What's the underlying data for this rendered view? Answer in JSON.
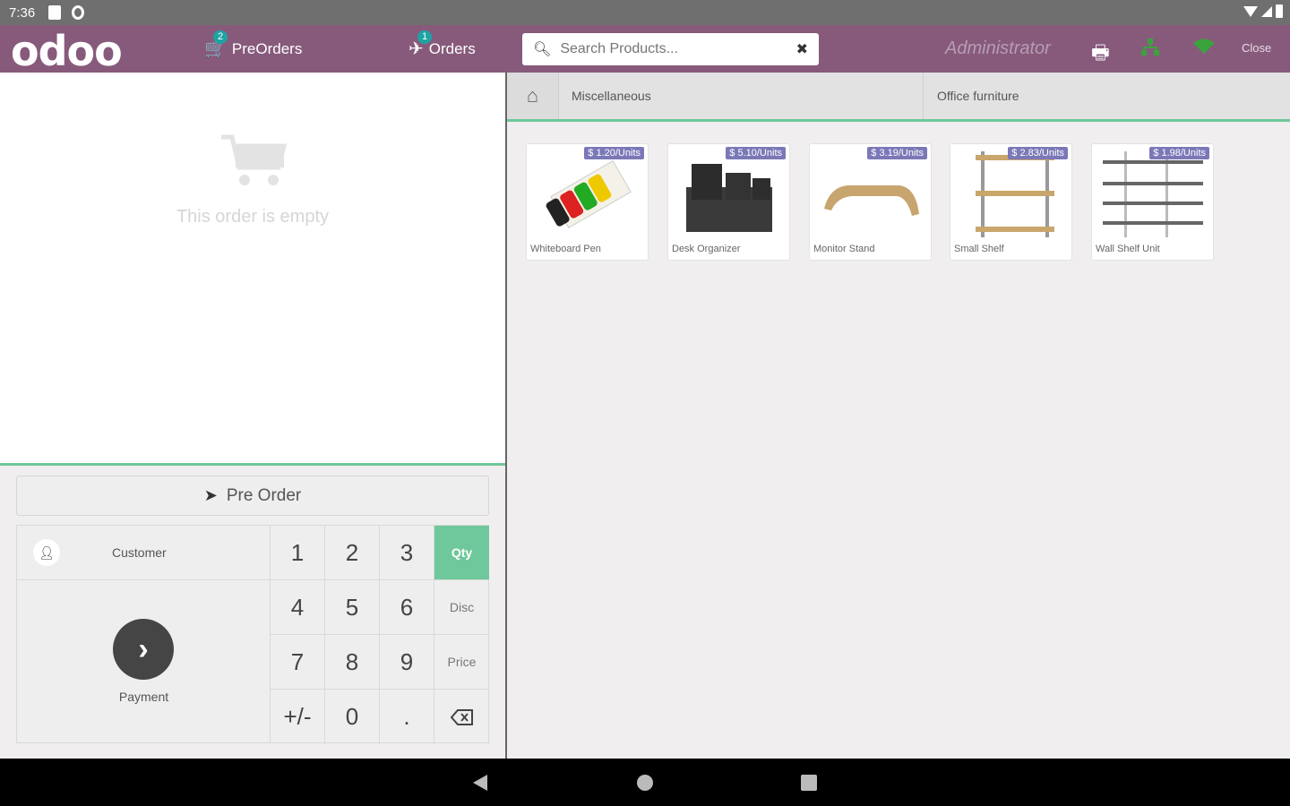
{
  "status_bar": {
    "time": "7:36"
  },
  "header": {
    "logo": "odoo",
    "preorders": {
      "label": "PreOrders",
      "badge": "2"
    },
    "orders": {
      "label": "Orders",
      "badge": "1"
    },
    "search_placeholder": "Search Products...",
    "user": "Administrator",
    "close_label": "Close"
  },
  "order": {
    "empty_text": "This order is empty"
  },
  "actions": {
    "preorder_label": "Pre Order",
    "customer_label": "Customer",
    "payment_label": "Payment"
  },
  "numpad": {
    "keys": [
      "1",
      "2",
      "3",
      "4",
      "5",
      "6",
      "7",
      "8",
      "9",
      "+/-",
      "0",
      "."
    ],
    "modes": [
      "Qty",
      "Disc",
      "Price"
    ],
    "active_mode": "Qty"
  },
  "categories": [
    "Miscellaneous",
    "Office furniture"
  ],
  "products": [
    {
      "name": "Whiteboard Pen",
      "price": "$ 1.20/Units"
    },
    {
      "name": "Desk Organizer",
      "price": "$ 5.10/Units"
    },
    {
      "name": "Monitor Stand",
      "price": "$ 3.19/Units"
    },
    {
      "name": "Small Shelf",
      "price": "$ 2.83/Units"
    },
    {
      "name": "Wall Shelf Unit",
      "price": "$ 1.98/Units"
    }
  ],
  "colors": {
    "brand": "#875a7b",
    "accent": "#6ec89b",
    "price_tag": "#7b78b8"
  }
}
